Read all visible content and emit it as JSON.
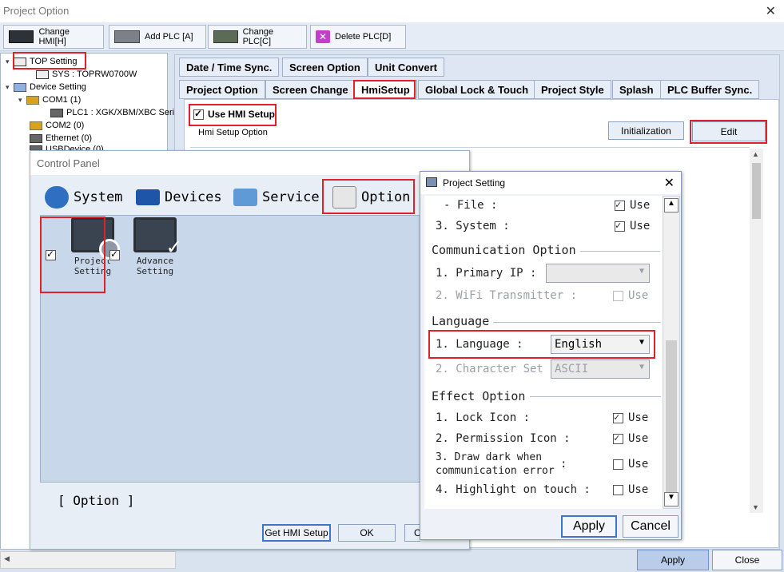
{
  "window": {
    "title": "Project Option",
    "close": "✕"
  },
  "toolbar": {
    "change_hmi": "Change HMI[H]",
    "add_plc": "Add PLC [A]",
    "change_plc": "Change PLC[C]",
    "delete_plc": "Delete PLC[D]"
  },
  "tree": {
    "top_setting": "TOP Setting",
    "sys": "SYS : TOPRW0700W",
    "device_setting": "Device Setting",
    "com1": "COM1 (1)",
    "plc1": "PLC1 : XGK/XBM/XBC Serie",
    "com2": "COM2 (0)",
    "ethernet": "Ethernet (0)",
    "usb": "USBDevice (0)"
  },
  "tabs_row1": [
    "Date / Time Sync.",
    "Screen Option",
    "Unit Convert"
  ],
  "tabs_row2": [
    "Project Option",
    "Screen Change",
    "HmiSetup",
    "Global Lock & Touch",
    "Project Style",
    "Splash",
    "PLC Buffer Sync."
  ],
  "hmi": {
    "use_label": "Use HMI Setup",
    "option_label": "Hmi Setup Option",
    "init_button": "Initialization",
    "edit_button": "Edit"
  },
  "control_panel": {
    "title": "Control Panel",
    "tabs": [
      "System",
      "Devices",
      "Service",
      "Option"
    ],
    "items": [
      {
        "line1": "Project",
        "line2": "Setting"
      },
      {
        "line1": "Advance",
        "line2": "Setting"
      }
    ],
    "section_label": "[ Option ]",
    "get_hmi": "Get HMI Setup",
    "ok": "OK",
    "cancel_partial": "C"
  },
  "project_setting": {
    "title": "Project Setting",
    "file_row": "- File :",
    "system_row": "3. System :",
    "use": "Use",
    "comm_header": "Communication Option",
    "primary_ip": "1. Primary IP :",
    "wifi": "2. WiFi Transmitter :",
    "lang_header": "Language",
    "language": "1. Language :",
    "language_value": "English",
    "charset": "2. Character Set :",
    "charset_value": "ASCII",
    "effect_header": "Effect Option",
    "lock_icon": "1. Lock Icon :",
    "perm_icon": "2. Permission Icon :",
    "draw_dark_1": "3. Draw dark when",
    "draw_dark_2": "communication error",
    "draw_dark_colon": ":",
    "highlight": "4. Highlight on touch :",
    "apply": "Apply",
    "cancel": "Cancel"
  },
  "footer": {
    "apply": "Apply",
    "close": "Close"
  },
  "colors": {
    "highlight": "#e0202a",
    "accent": "#3f74c8"
  }
}
